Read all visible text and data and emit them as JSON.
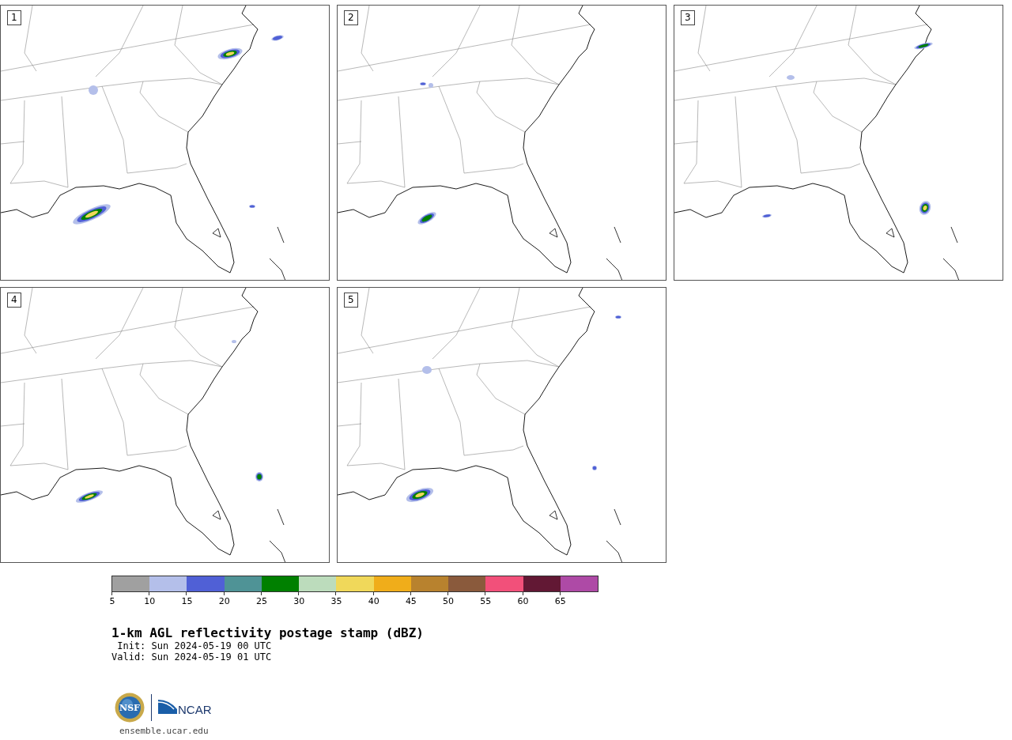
{
  "panels": [
    {
      "label": "1"
    },
    {
      "label": "2"
    },
    {
      "label": "3"
    },
    {
      "label": "4"
    },
    {
      "label": "5"
    }
  ],
  "colorbar": {
    "segments": [
      {
        "color": "#a0a0a0"
      },
      {
        "color": "#b4bfea"
      },
      {
        "color": "#5060d6"
      },
      {
        "color": "#4f9396"
      },
      {
        "color": "#008000"
      },
      {
        "color": "#bcdcbc"
      },
      {
        "color": "#f0d85a"
      },
      {
        "color": "#f0ad1a"
      },
      {
        "color": "#b8822e"
      },
      {
        "color": "#8a5a3c"
      },
      {
        "color": "#f2507a"
      },
      {
        "color": "#621834"
      },
      {
        "color": "#ae4aa6"
      }
    ],
    "ticks": [
      "5",
      "10",
      "15",
      "20",
      "25",
      "30",
      "35",
      "40",
      "45",
      "50",
      "55",
      "60",
      "65"
    ]
  },
  "title": "1-km AGL reflectivity postage stamp (dBZ)",
  "init": "Init: Sun 2024-05-19 00 UTC",
  "valid": "Valid: Sun 2024-05-19 01 UTC",
  "logos": {
    "nsf": "NSF",
    "ncar": "NCAR"
  },
  "footer": "ensemble.ucar.edu"
}
